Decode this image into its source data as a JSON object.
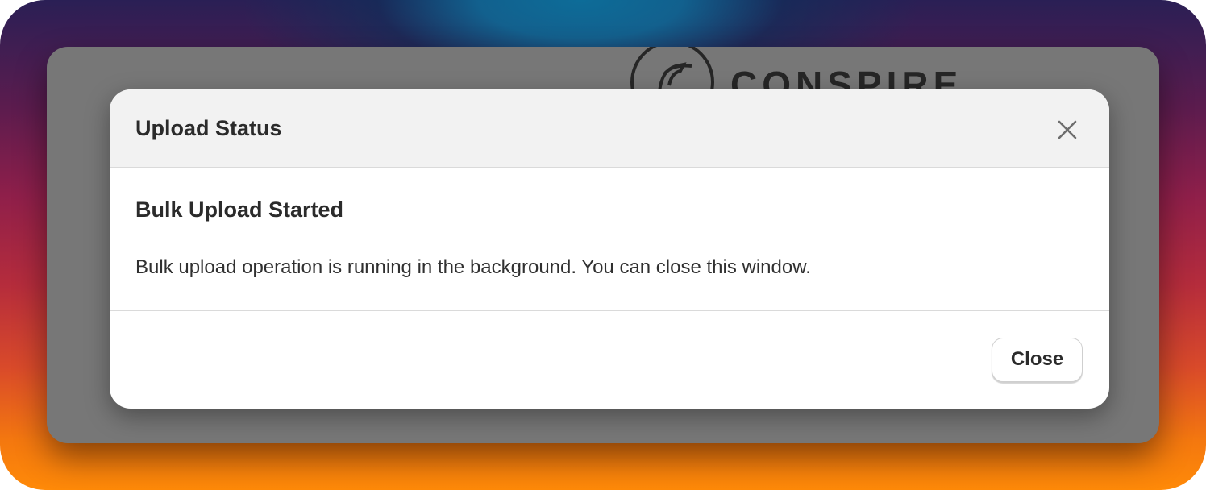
{
  "background_app": {
    "brand_name": "CONSPIRE"
  },
  "modal": {
    "title": "Upload Status",
    "close_icon": "close-icon",
    "heading": "Bulk Upload Started",
    "message": "Bulk upload operation is running in the background. You can close this window.",
    "footer": {
      "close_button_label": "Close"
    }
  },
  "colors": {
    "header_background": "#f2f2f2",
    "overlay": "#777777",
    "gradient_top": "#0d6c98",
    "gradient_bottom": "#ff8a08"
  }
}
